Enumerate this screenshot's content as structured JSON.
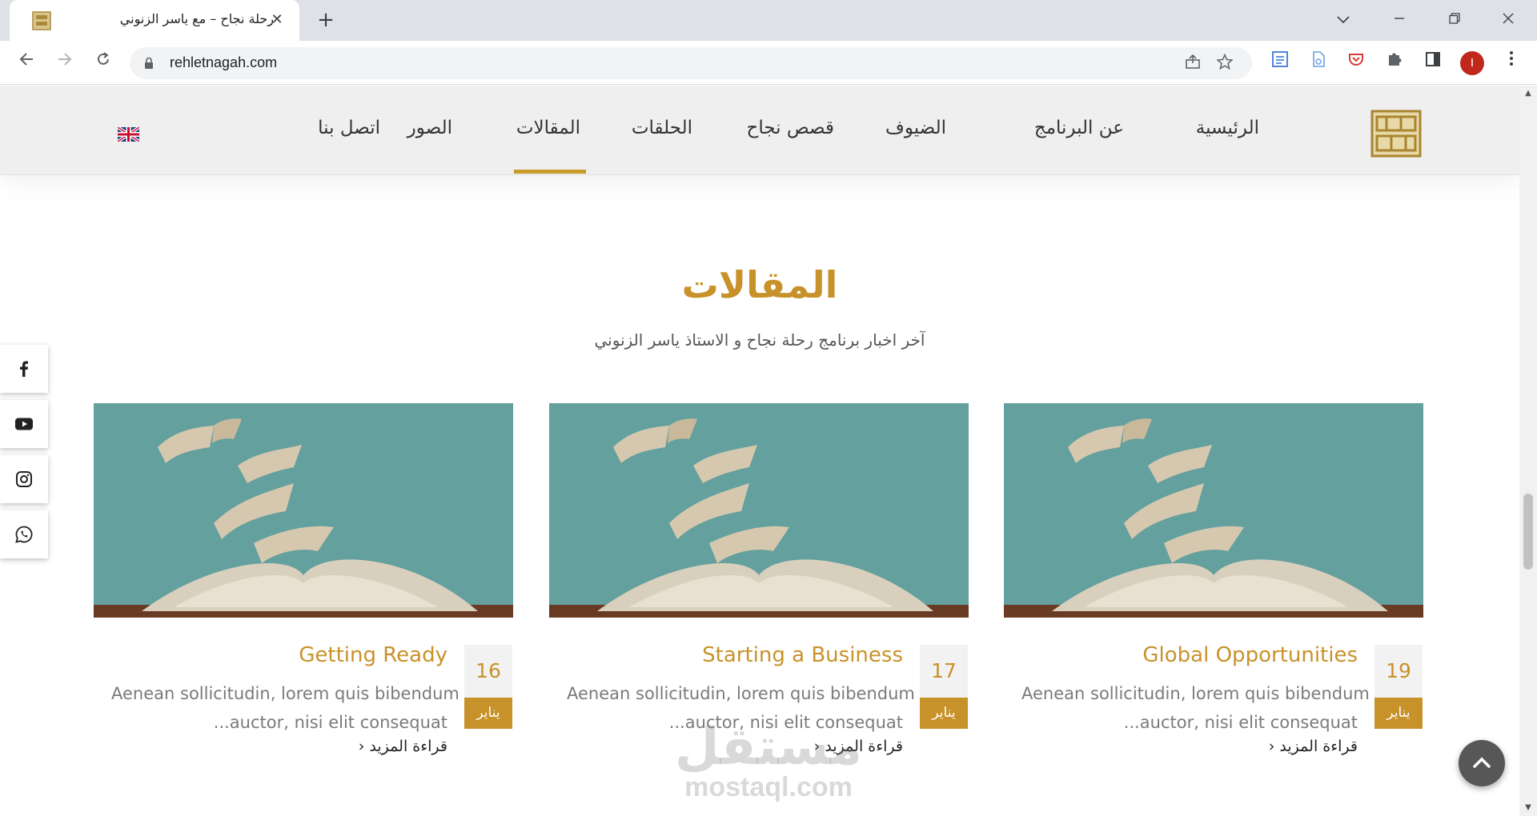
{
  "browser": {
    "tab_title": "رحلة نجاح – مع ياسر الزنوني",
    "tab_close": "✕",
    "new_tab": "+",
    "url": "rehletnagah.com",
    "profile_initial": "I"
  },
  "site": {
    "nav": {
      "items": [
        "الرئيسية",
        "عن البرنامج",
        "الضيوف",
        "قصص نجاح",
        "الحلقات",
        "المقالات",
        "الصور",
        "اتصل بنا"
      ],
      "active": "المقالات"
    },
    "language_flag": "uk-flag-icon"
  },
  "articles_section": {
    "title": "المقالات",
    "subtitle": "آخر اخبار برنامج رحلة نجاح و الاستاذ ياسر الزنوني",
    "cards": [
      {
        "day": "19",
        "month": "يناير",
        "title": "Global Opportunities",
        "excerpt_line1": "Aenean sollicitudin, lorem quis bibendum",
        "excerpt_line2": "...auctor, nisi elit consequat",
        "read_more": "قراءة المزيد"
      },
      {
        "day": "17",
        "month": "يناير",
        "title": "Starting a Business",
        "excerpt_line1": "Aenean sollicitudin, lorem quis bibendum",
        "excerpt_line2": "...auctor, nisi elit consequat",
        "read_more": "قراءة المزيد"
      },
      {
        "day": "16",
        "month": "يناير",
        "title": "Getting Ready",
        "excerpt_line1": "Aenean sollicitudin, lorem quis bibendum",
        "excerpt_line2": "...auctor, nisi elit consequat",
        "read_more": "قراءة المزيد"
      }
    ]
  },
  "social": [
    "facebook-icon",
    "youtube-icon",
    "instagram-icon",
    "whatsapp-icon"
  ],
  "watermark": {
    "ar": "مستقل",
    "en": "mostaql.com"
  },
  "colors": {
    "gold": "#c8922a",
    "header_bg": "#efefef",
    "image_teal": "#5f9c9a"
  }
}
